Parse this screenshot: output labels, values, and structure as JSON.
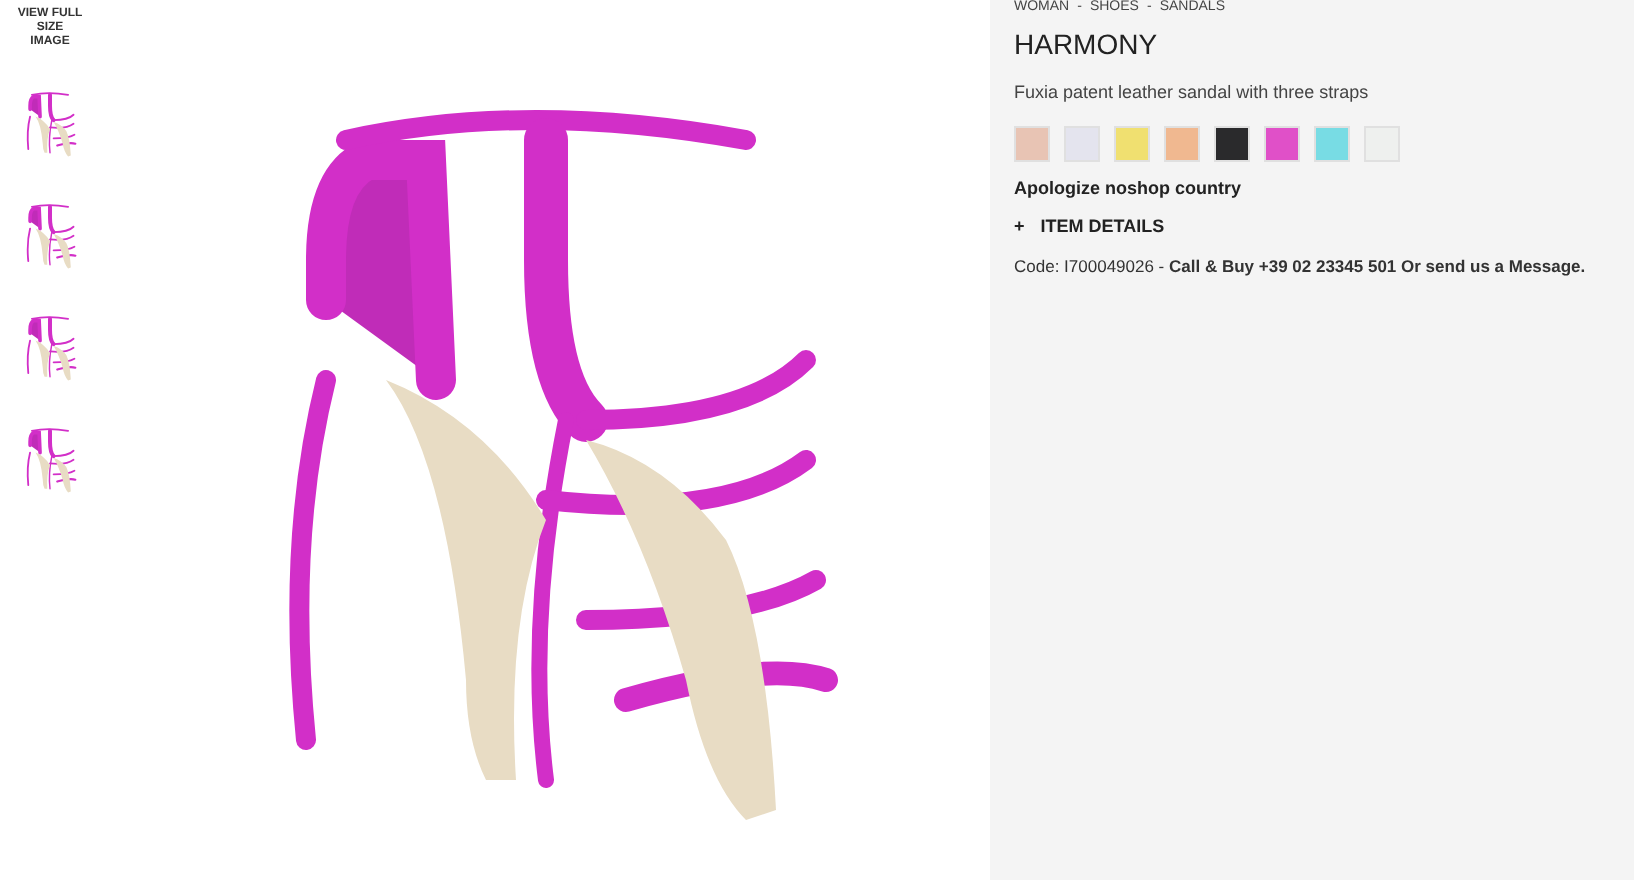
{
  "gallery": {
    "view_full_label": "VIEW FULL SIZE IMAGE",
    "thumbnails": [
      {
        "selected": false
      },
      {
        "selected": false
      },
      {
        "selected": false
      },
      {
        "selected": false
      }
    ]
  },
  "breadcrumb": {
    "items": [
      "WOMAN",
      "SHOES",
      "SANDALS"
    ],
    "separator": "-"
  },
  "product": {
    "title": "HARMONY",
    "description": "Fuxia patent leather sandal with three straps",
    "swatches": [
      {
        "color": "#e8c4b4"
      },
      {
        "color": "#e4e4ee"
      },
      {
        "color": "#f0e070"
      },
      {
        "color": "#f0b890"
      },
      {
        "color": "#2a2a2c"
      },
      {
        "color": "#e050c8"
      },
      {
        "color": "#78dce4"
      },
      {
        "color": "#eef0ee"
      }
    ],
    "availability": "Apologize noshop country",
    "details_toggle": {
      "icon": "+",
      "label": "ITEM DETAILS",
      "expanded": false
    },
    "code_line": "Code: I700049026 - **Call & Buy +39 02 23345 501 Or send us a Message.**"
  }
}
